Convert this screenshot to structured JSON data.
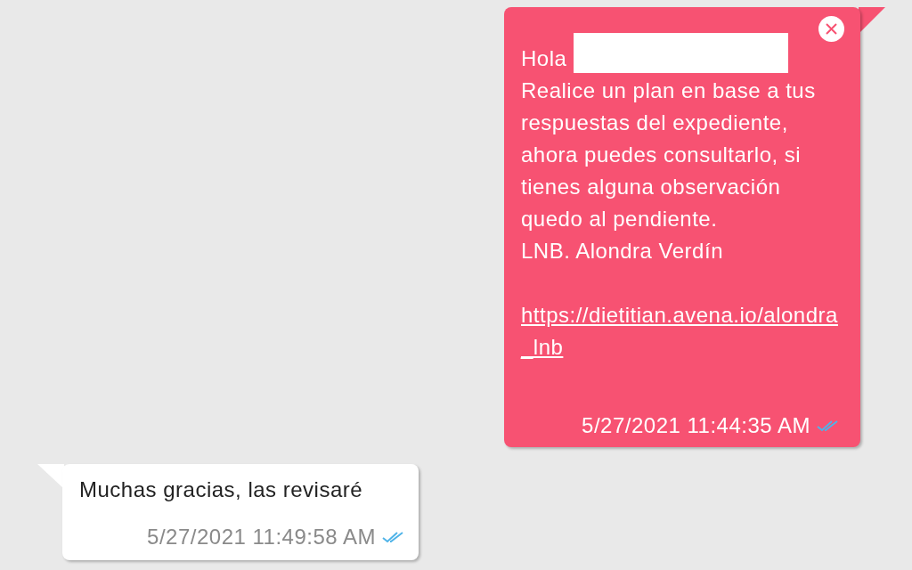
{
  "messages": [
    {
      "kind": "outgoing",
      "greeting": "Hola",
      "redacted": true,
      "closable": true,
      "lines": [
        "Realice un plan en base a tus respuestas del expediente, ahora puedes consultarlo, si tienes alguna observación quedo al pendiente.",
        "LNB. Alondra Verdín"
      ],
      "link": "https://dietitian.avena.io/alondra_lnb",
      "time": "5/27/2021 11:44:35 AM",
      "read": true
    },
    {
      "kind": "incoming",
      "lines": [
        "Muchas gracias, las revisaré"
      ],
      "time": "5/27/2021 11:49:58 AM",
      "read": true
    }
  ]
}
